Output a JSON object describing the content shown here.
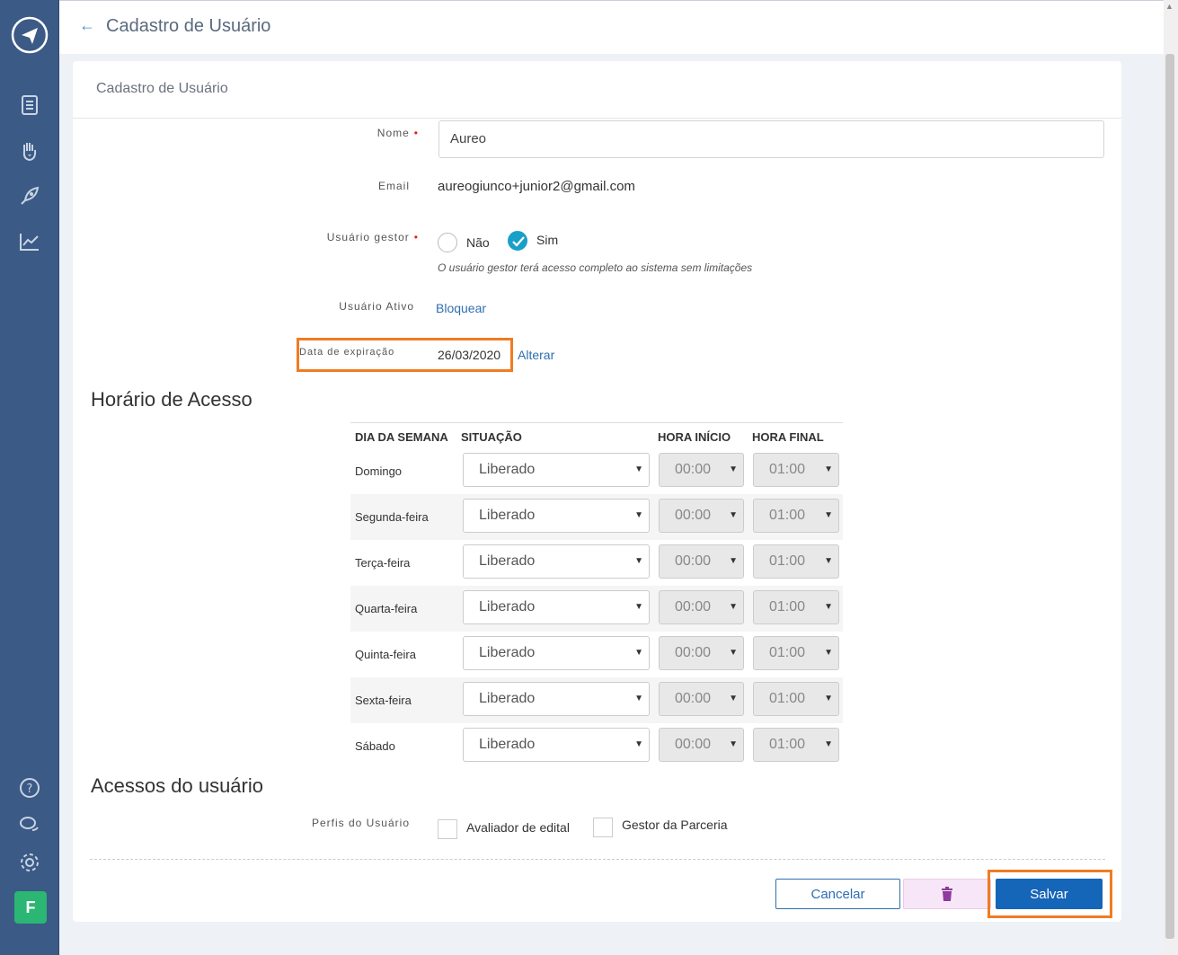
{
  "header": {
    "title": "Cadastro de Usuário"
  },
  "card": {
    "title": "Cadastro de Usuário"
  },
  "form": {
    "nome_label": "Nome",
    "nome_value": "Aureo",
    "email_label": "Email",
    "email_value": "aureogiunco+junior2@gmail.com",
    "gestor_label": "Usuário gestor",
    "gestor_nao": "Não",
    "gestor_sim": "Sim",
    "gestor_selected": "Sim",
    "gestor_hint": "O usuário gestor terá acesso completo ao sistema sem limitações",
    "ativo_label": "Usuário Ativo",
    "ativo_link": "Bloquear",
    "expiracao_label": "Data de expiração",
    "expiracao_value": "26/03/2020",
    "expiracao_link": "Alterar"
  },
  "schedule": {
    "title": "Horário de Acesso",
    "headers": [
      "DIA DA SEMANA",
      "SITUAÇÃO",
      "HORA INÍCIO",
      "HORA FINAL"
    ],
    "rows": [
      {
        "day": "Domingo",
        "status": "Liberado",
        "start": "00:00",
        "end": "01:00"
      },
      {
        "day": "Segunda-feira",
        "status": "Liberado",
        "start": "00:00",
        "end": "01:00"
      },
      {
        "day": "Terça-feira",
        "status": "Liberado",
        "start": "00:00",
        "end": "01:00"
      },
      {
        "day": "Quarta-feira",
        "status": "Liberado",
        "start": "00:00",
        "end": "01:00"
      },
      {
        "day": "Quinta-feira",
        "status": "Liberado",
        "start": "00:00",
        "end": "01:00"
      },
      {
        "day": "Sexta-feira",
        "status": "Liberado",
        "start": "00:00",
        "end": "01:00"
      },
      {
        "day": "Sábado",
        "status": "Liberado",
        "start": "00:00",
        "end": "01:00"
      }
    ]
  },
  "access": {
    "title": "Acessos do usuário",
    "profiles_label": "Perfis do Usuário",
    "profiles": [
      "Avaliador de edital",
      "Gestor da Parceria"
    ]
  },
  "actions": {
    "cancel": "Cancelar",
    "save": "Salvar"
  },
  "sidebar": {
    "icons": [
      "logo-icon",
      "document-icon",
      "hand-heart-icon",
      "rocket-icon",
      "chart-icon",
      "help-icon",
      "chat-icon",
      "gear-icon"
    ],
    "avatar": "F"
  },
  "colors": {
    "sidebar": "#3b5a86",
    "primary": "#1565b8",
    "accent": "#19a0c8",
    "highlight": "#f07c22"
  }
}
